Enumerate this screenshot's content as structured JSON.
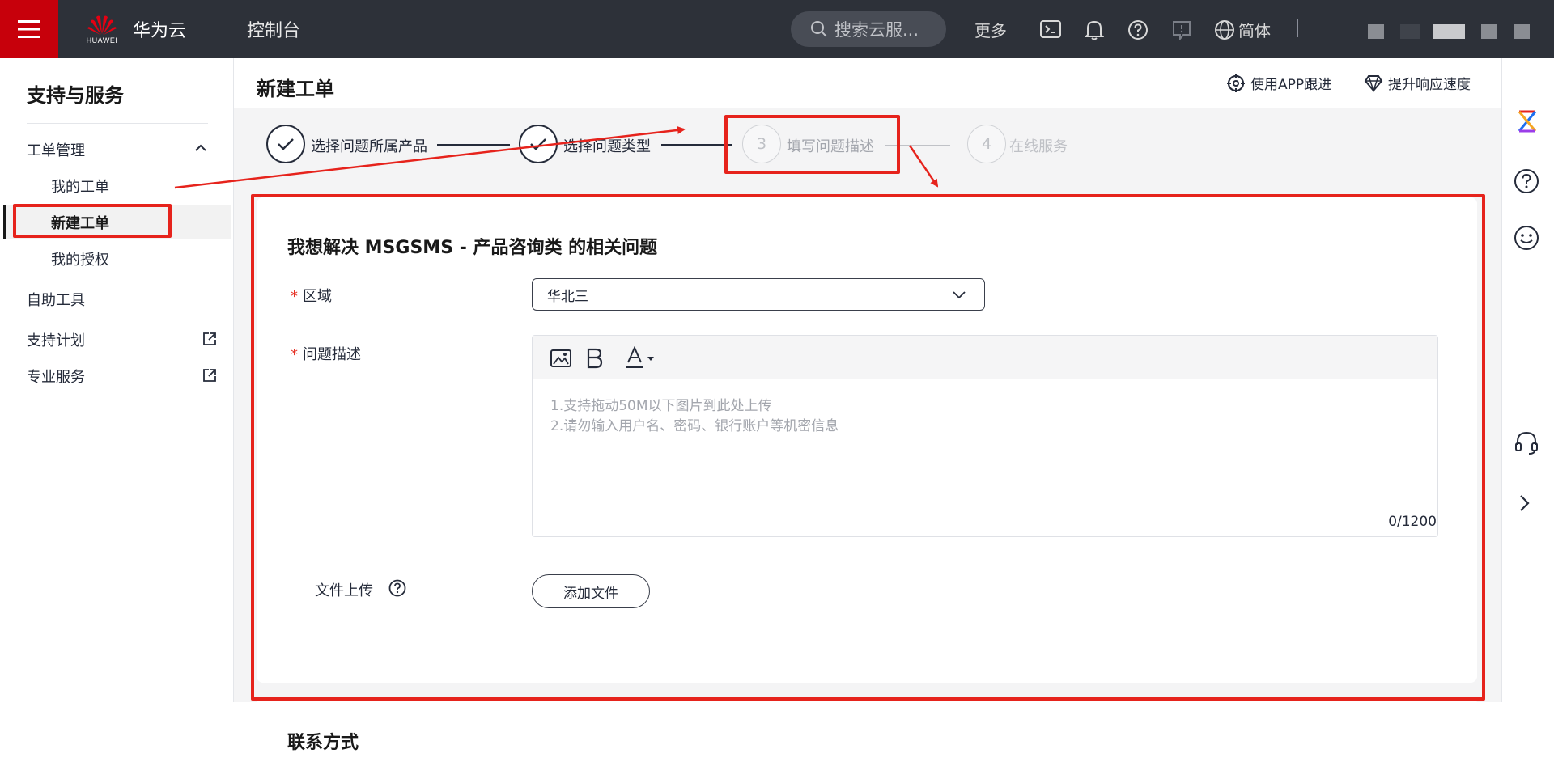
{
  "topbar": {
    "brand": "华为云",
    "logo_text": "HUAWEI",
    "console": "控制台",
    "search_placeholder": "搜索云服...",
    "more": "更多",
    "language": "简体",
    "icons": [
      "menu-icon",
      "huawei-logo",
      "search-icon",
      "terminal-icon",
      "bell-icon",
      "help-icon",
      "feedback-icon",
      "globe-icon"
    ]
  },
  "sidebar": {
    "title": "支持与服务",
    "group": "工单管理",
    "items": [
      {
        "label": "我的工单"
      },
      {
        "label": "新建工单",
        "active": true
      },
      {
        "label": "我的授权"
      }
    ],
    "self_tools": "自助工具",
    "support_plan": "支持计划",
    "pro_service": "专业服务"
  },
  "header": {
    "title": "新建工单",
    "app_track": "使用APP跟进",
    "speed_up": "提升响应速度"
  },
  "steps": [
    {
      "label": "选择问题所属产品",
      "status": "done"
    },
    {
      "label": "选择问题类型",
      "status": "done"
    },
    {
      "number": "3",
      "label": "填写问题描述",
      "status": "current"
    },
    {
      "number": "4",
      "label": "在线服务",
      "status": "todo"
    }
  ],
  "form": {
    "title": "我想解决 MSGSMS - 产品咨询类 的相关问题",
    "region_label": "区域",
    "region_value": "华北三",
    "desc_label": "问题描述",
    "desc_placeholder_1": "1.支持拖动50M以下图片到此处上传",
    "desc_placeholder_2": "2.请勿输入用户名、密码、银行账户等机密信息",
    "counter": "0/1200",
    "upload_label": "文件上传",
    "add_file": "添加文件"
  },
  "contact": {
    "title": "联系方式"
  },
  "colors": {
    "topbar": "#2d3139",
    "brand_red": "#c7000b",
    "annotation_red": "#e6231c"
  }
}
